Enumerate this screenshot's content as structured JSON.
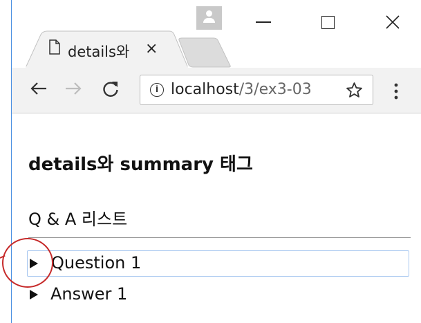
{
  "browser": {
    "tab_title": "details와",
    "tab_close_glyph": "×",
    "url_host": "localhost",
    "url_path": "/3/ex3-03",
    "info_glyph": "i"
  },
  "page": {
    "heading": "details와 summary 태그",
    "subtitle": "Q & A 리스트",
    "details": [
      {
        "summary": "Question 1"
      },
      {
        "summary": "Answer 1"
      }
    ]
  },
  "colors": {
    "focus_outline": "#a8c7f0",
    "annotation": "#c62a2a",
    "toolbar": "#f2f2f2"
  }
}
